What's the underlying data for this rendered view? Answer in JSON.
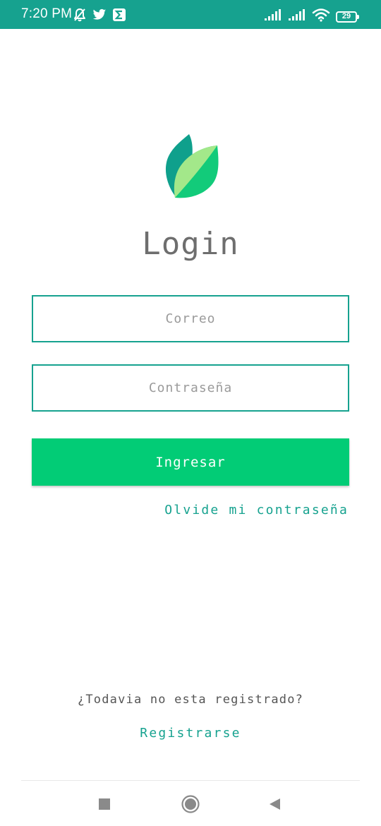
{
  "status_bar": {
    "time": "7:20 PM",
    "battery_level": "29",
    "icons": [
      "bell-off-icon",
      "twitter-icon",
      "sigma-app-icon",
      "signal-icon",
      "signal-icon",
      "wifi-icon",
      "battery-icon"
    ]
  },
  "login": {
    "title": "Login",
    "email_placeholder": "Correo",
    "password_placeholder": "Contraseña",
    "submit_label": "Ingresar",
    "forgot_password_label": "Olvide mi contraseña"
  },
  "footer": {
    "question": "¿Todavia no esta registrado?",
    "register_label": "Registrarse"
  },
  "nav": {
    "icons": [
      "recents-square-icon",
      "home-circle-icon",
      "back-triangle-icon"
    ]
  },
  "colors": {
    "accent": "#16a28f",
    "button": "#02cc76",
    "leaf_dark": "#0fa08c",
    "leaf_light": "#a3e88a",
    "leaf_mid": "#12cb7a"
  }
}
